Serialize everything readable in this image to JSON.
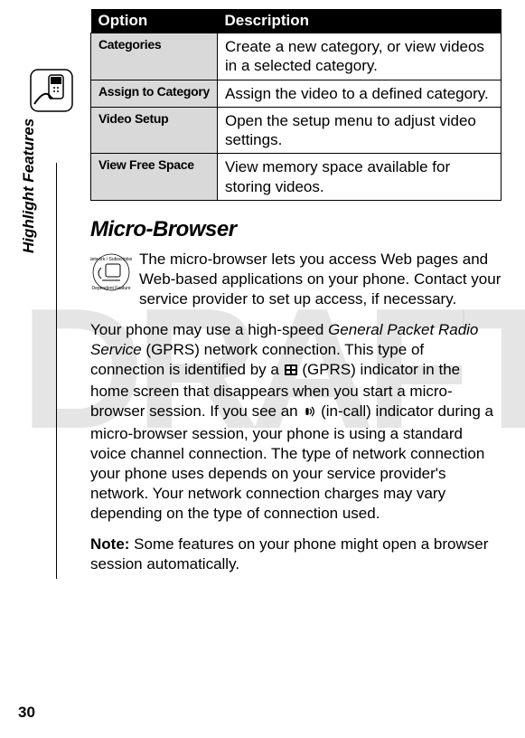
{
  "watermark": "DRAFT",
  "side_label": "Highlight Features",
  "page_number": "30",
  "table": {
    "header_option": "Option",
    "header_desc": "Description",
    "rows": [
      {
        "opt": "Categories",
        "desc": "Create a new category, or view videos in a selected category."
      },
      {
        "opt": "Assign to Category",
        "desc": "Assign the video to a defined category."
      },
      {
        "opt": "Video Setup",
        "desc": "Open the setup menu to adjust video settings."
      },
      {
        "opt": "View Free Space",
        "desc": "View memory space available for storing videos."
      }
    ]
  },
  "section_title": "Micro-Browser",
  "intro_text": "The micro-browser lets you access Web pages and Web-based applications on your phone. Contact your service provider to set up access, if necessary.",
  "body": {
    "pre_gprs": "Your phone may use a high-speed ",
    "gprs_full": "General Packet Radio Service",
    "post_gprs": " (GPRS) network connection. This type of connection is identified by a ",
    "gprs_icon_label": "(GPRS)",
    "after_gprs_icon": " indicator in the home screen that disappears when you start a micro-browser session. If you see an ",
    "in_call_label": "(in-call)",
    "after_in_call": " indicator during a micro-browser session, your phone is using a standard voice channel connection. The type of network connection your phone uses depends on your service provider's network. Your network connection charges may vary depending on the type of connection used."
  },
  "note_label": "Note:",
  "note_text": " Some features on your phone might open a browser session automatically."
}
